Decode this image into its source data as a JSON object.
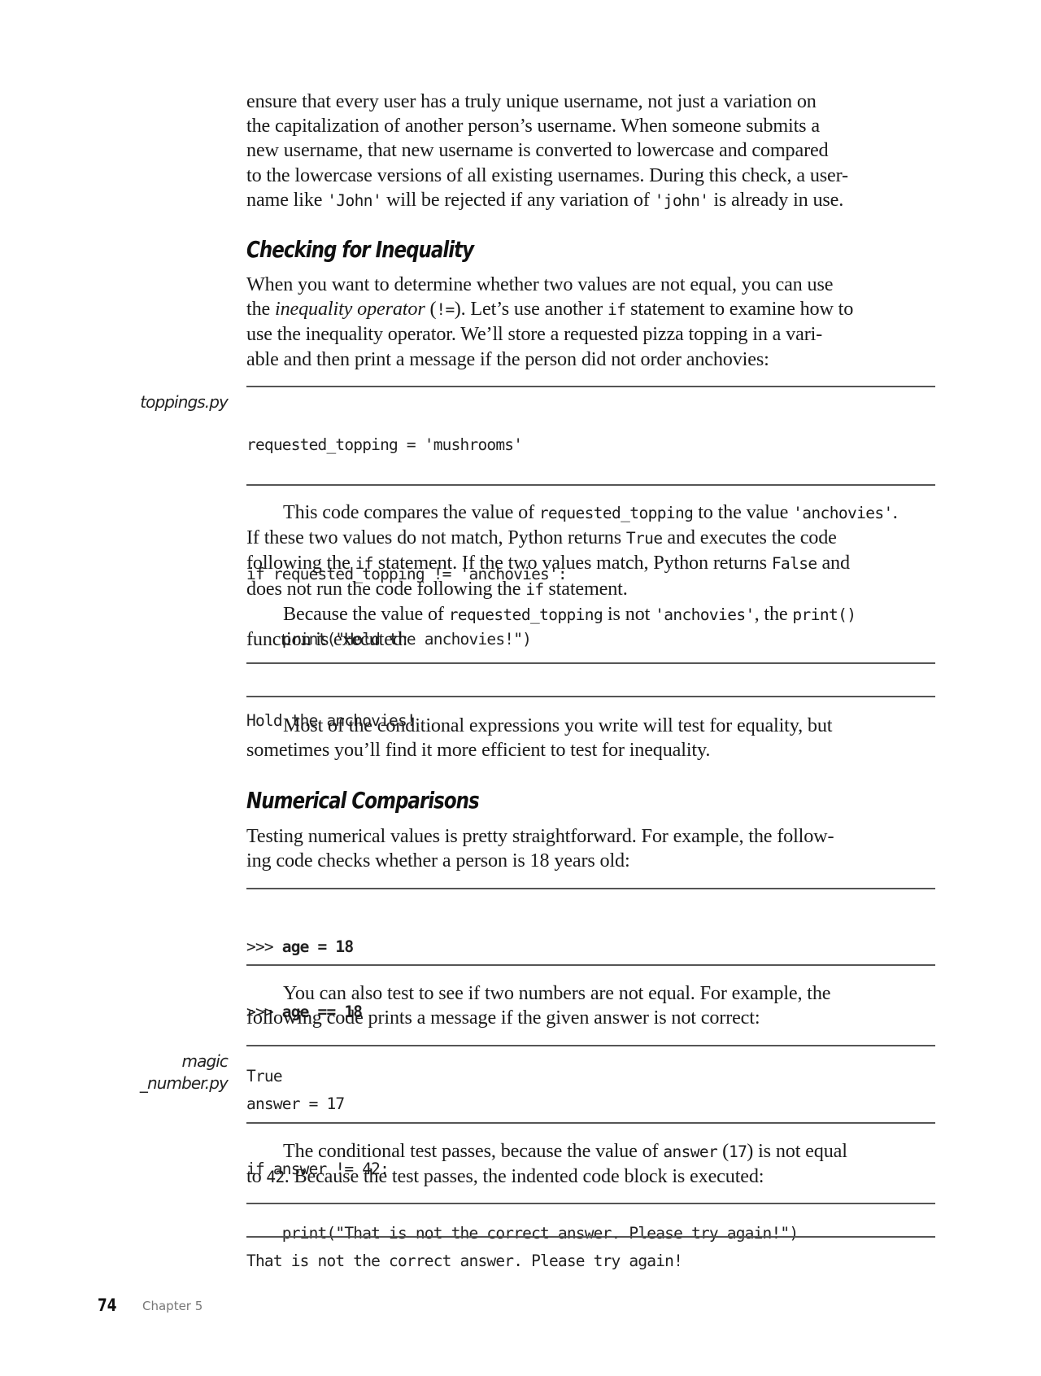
{
  "page": {
    "number": "74",
    "chapter": "Chapter 5"
  },
  "para1": {
    "lines": [
      "ensure that every user has a truly unique username, not just a variation on",
      "the capitalization of another person’s username. When someone submits a",
      "new username, that new username is converted to lowercase and compared",
      "to the lowercase versions of all existing usernames. During this check, a user-"
    ],
    "last_pre": "name like ",
    "last_code1": "'John'",
    "last_mid": " will be rejected if any variation of ",
    "last_code2": "'john'",
    "last_post": " is already in use."
  },
  "heading1": "Checking for Inequality",
  "para2": {
    "line1": "When you want to determine whether two values are not equal, you can use",
    "line2_pre": "the ",
    "line2_em": "inequality operator",
    "line2_mid1": " (",
    "line2_code1": "!=",
    "line2_mid2": "). Let’s use another ",
    "line2_code2": "if",
    "line2_post": " statement to examine how to",
    "line3": "use the inequality operator. We’ll store a requested pizza topping in a vari-",
    "line4": "able and then print a message if the person did not order anchovies:"
  },
  "code1": {
    "filename": "toppings.py",
    "lines": [
      "requested_topping = 'mushrooms'",
      "",
      "if requested_topping != 'anchovies':",
      "    print(\"Hold the anchovies!\")"
    ]
  },
  "para3": {
    "l1_pre": "This code compares the value of ",
    "l1_code1": "requested_topping",
    "l1_mid": " to the value ",
    "l1_code2": "'anchovies'",
    "l1_post": ".",
    "l2_pre": "If these two values do not match, Python returns ",
    "l2_code": "True",
    "l2_post": " and executes the code",
    "l3_pre": "following the ",
    "l3_code1": "if",
    "l3_mid": " statement. If the two values match, Python returns ",
    "l3_code2": "False",
    "l3_post": " and",
    "l4_pre": "does not run the code following the ",
    "l4_code": "if",
    "l4_post": " statement.",
    "l5_pre": "Because the value of ",
    "l5_code1": "requested_topping",
    "l5_mid": " is not ",
    "l5_code2": "'anchovies'",
    "l5_mid2": ", the ",
    "l5_code3": "print()",
    "l6": "function is executed:"
  },
  "output1": "Hold the anchovies!",
  "para4": {
    "line1": "Most of the conditional expressions you write will test for equality, but",
    "line2": "sometimes you’ll find it more efficient to test for inequality."
  },
  "heading2": "Numerical Comparisons",
  "para5": {
    "line1": "Testing numerical values is pretty straightforward. For example, the follow-",
    "line2": "ing code checks whether a person is 18 years old:"
  },
  "code2": {
    "lines": [
      {
        "prompt": ">>> ",
        "input": "age = 18"
      },
      {
        "prompt": ">>> ",
        "input": "age == 18"
      },
      {
        "prompt": "",
        "output": "True"
      }
    ]
  },
  "para6": {
    "line1": "You can also test to see if two numbers are not equal. For example, the",
    "line2": "following code prints a message if the given answer is not correct:"
  },
  "code3": {
    "filename_line1": "magic",
    "filename_line2": "_number.py",
    "lines": [
      "answer = 17",
      "if answer != 42:",
      "    print(\"That is not the correct answer. Please try again!\")"
    ]
  },
  "para7": {
    "l1_pre": "The conditional test passes, because the value of ",
    "l1_code1": "answer",
    "l1_mid": " (",
    "l1_code2": "17",
    "l1_post": ") is not equal",
    "l2_pre": "to ",
    "l2_code": "42",
    "l2_post": ". Because the test passes, the indented code block is executed:"
  },
  "output2": "That is not the correct answer. Please try again!"
}
